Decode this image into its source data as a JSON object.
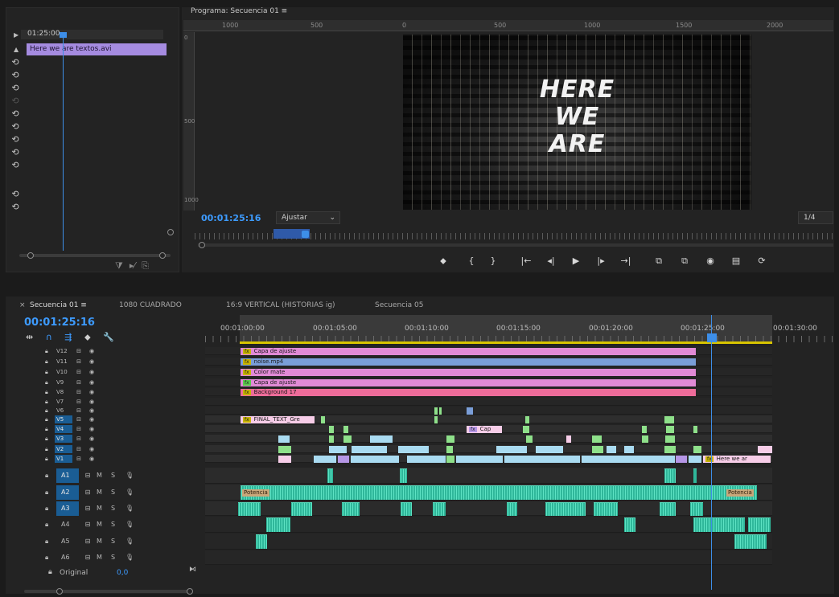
{
  "source": {
    "timecode": "01:25:00",
    "clip_label": "Here we are textos.avi",
    "undo_glyph": "⟲"
  },
  "program": {
    "tab_title": "Programa: Secuencia 01  ≡",
    "ruler_labels_top": [
      "1000",
      "500",
      "0",
      "500",
      "1000",
      "1500",
      "2000"
    ],
    "ruler_labels_left": [
      "0",
      "500",
      "1000"
    ],
    "title_lines": [
      "HERE",
      "WE",
      "ARE"
    ],
    "timecode": "00:01:25:16",
    "fit": "Ajustar",
    "resolution": "1/4",
    "transport": [
      "⬥",
      "{",
      "}",
      "|←",
      "◂|",
      "▶",
      "|▸",
      "→|",
      "⧉",
      "⧉",
      "◉",
      "▤",
      "⟳"
    ]
  },
  "timeline": {
    "tabs": [
      "Secuencia 01  ≡",
      "1080 CUADRADO",
      "16:9 VERTICAL (HISTORIAS ig)",
      "Secuencia 05"
    ],
    "close_glyph": "×",
    "timecode": "00:01:25:16",
    "tools": [
      "⇹",
      "∩",
      "⇶",
      "⬥",
      "🔧"
    ],
    "ruler_times": [
      "00:01:00:00",
      "00:01:05:00",
      "00:01:10:00",
      "00:01:15:00",
      "00:01:20:00",
      "00:01:25:00",
      "00:01:30:00"
    ],
    "video_tracks": [
      "V12",
      "V11",
      "V10",
      "V9",
      "V8",
      "V7",
      "V6",
      "V5",
      "V4",
      "V3",
      "V2",
      "V1"
    ],
    "active_video_tracks": [
      "V5",
      "V4",
      "V3",
      "V2",
      "V1"
    ],
    "audio_tracks": [
      "A1",
      "A2",
      "A3",
      "A4",
      "A5",
      "A6"
    ],
    "audio_buttons": [
      "M",
      "S"
    ],
    "clips": {
      "capa1": "Capa de ajuste",
      "noise": "noise.mp4",
      "color": "Color mate",
      "capa2": "Capa de ajuste",
      "bg": "Background 17",
      "final": "FINAL_TEXT_Gre",
      "cap": "Cap",
      "here": "Here we ar",
      "fx": "fx",
      "potencia1": "Potencia",
      "potencia2": "Potencia"
    },
    "original_label": "Original",
    "original_value": "0,0"
  },
  "colors": {
    "accent_blue": "#3d9bff",
    "work_area": "#d8c400",
    "audio_clip": "#2fb79a",
    "pink_clip": "#e18ad6"
  }
}
